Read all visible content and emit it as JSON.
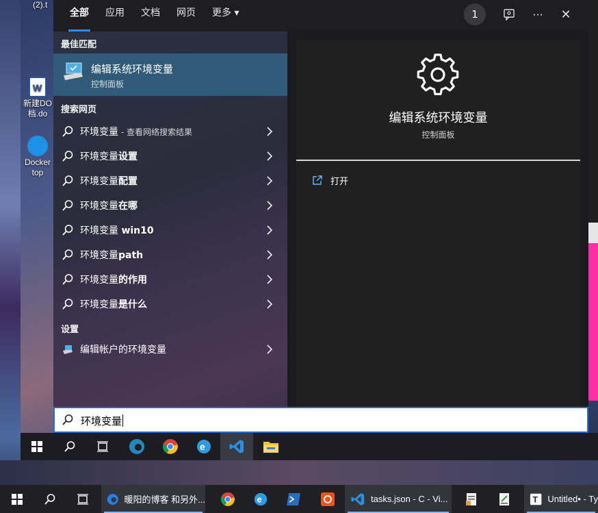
{
  "desktop": {
    "file_label_top": "(2).t",
    "word_doc_label": "新建DO\n档.do",
    "docker_label": "Docker\ntop"
  },
  "topbar": {
    "tabs": [
      {
        "label": "全部"
      },
      {
        "label": "应用"
      },
      {
        "label": "文档"
      },
      {
        "label": "网页"
      },
      {
        "label": "更多 ▾"
      }
    ],
    "badge": "1",
    "more_glyph": "···",
    "close_glyph": "✕"
  },
  "results": {
    "best_match_header": "最佳匹配",
    "best_match": {
      "title": "编辑系统环境变量",
      "subtitle": "控制面板"
    },
    "web_header": "搜索网页",
    "web_items": [
      {
        "prefix": "环境变量",
        "bold": "",
        "hint": " - 查看网络搜索结果"
      },
      {
        "prefix": "环境变量",
        "bold": "设置",
        "hint": ""
      },
      {
        "prefix": "环境变量",
        "bold": "配置",
        "hint": ""
      },
      {
        "prefix": "环境变量",
        "bold": "在哪",
        "hint": ""
      },
      {
        "prefix": "环境变量 ",
        "bold": "win10",
        "hint": ""
      },
      {
        "prefix": "环境变量",
        "bold": "path",
        "hint": ""
      },
      {
        "prefix": "环境变量",
        "bold": "的作用",
        "hint": ""
      },
      {
        "prefix": "环境变量",
        "bold": "是什么",
        "hint": ""
      }
    ],
    "settings_header": "设置",
    "settings_item": "编辑帐户的环境变量"
  },
  "details": {
    "title": "编辑系统环境变量",
    "subtitle": "控制面板",
    "open_label": "打开"
  },
  "search": {
    "query": "环境变量"
  },
  "host_taskbar": {
    "edge_window": "暖阳的博客 和另外...",
    "vscode_window": "tasks.json - C - Vi...",
    "typora_window": "Untitled• - Ty"
  },
  "colors": {
    "accent": "#2d8cf0",
    "selected": "#305a78",
    "pink": "#ff2ea6"
  }
}
